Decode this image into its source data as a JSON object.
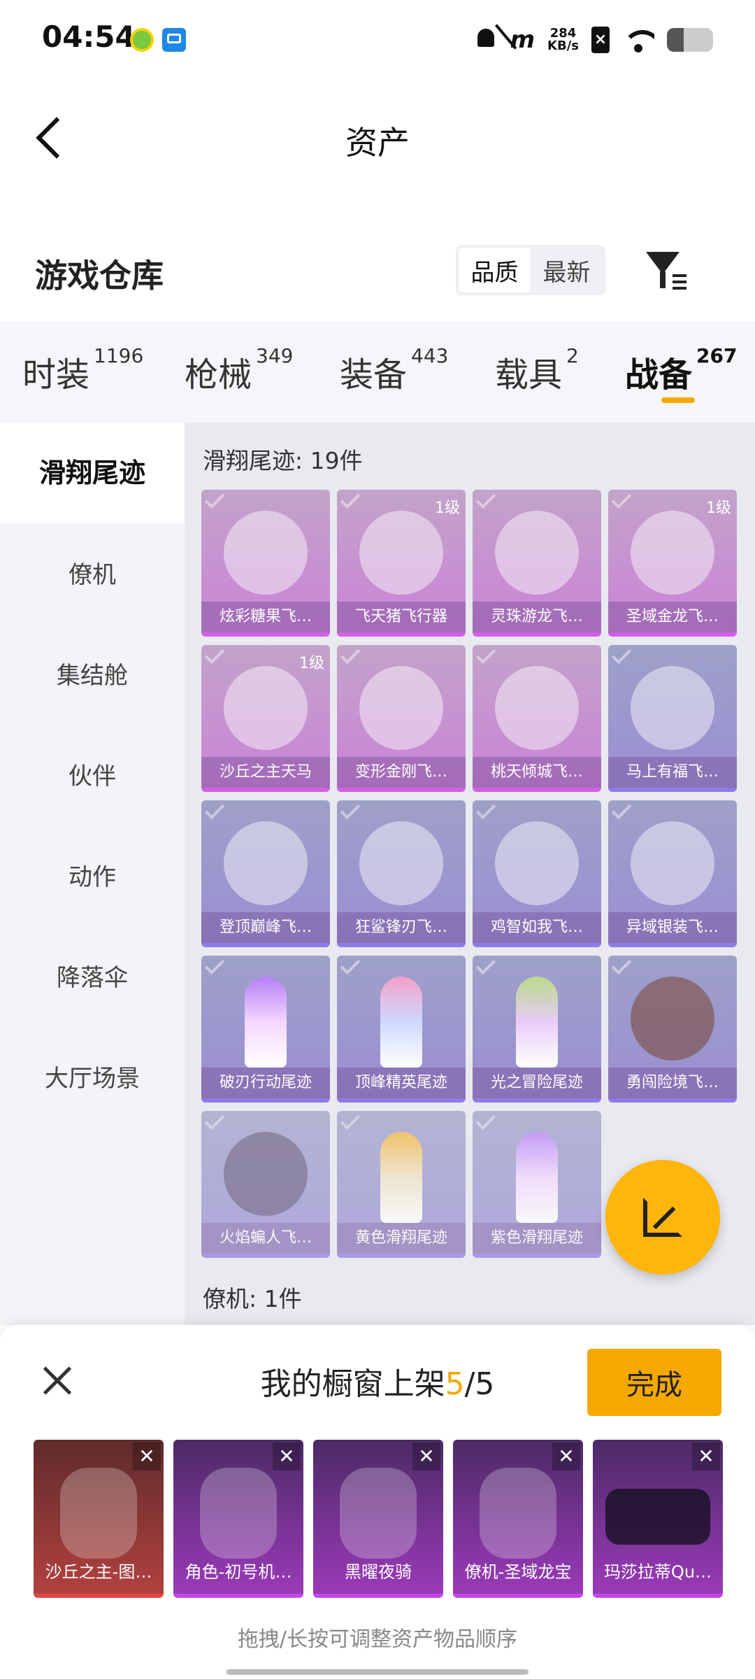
{
  "status": {
    "time": "04:54",
    "speed_top": "284",
    "speed_unit": "KB/s",
    "carrier_mark": "m"
  },
  "header": {
    "title": "资产"
  },
  "warehouse": {
    "title": "游戏仓库",
    "sort_options": [
      "品质",
      "最新"
    ],
    "sort_selected": "品质"
  },
  "tabs": [
    {
      "label": "时装",
      "count": "1196"
    },
    {
      "label": "枪械",
      "count": "349"
    },
    {
      "label": "装备",
      "count": "443"
    },
    {
      "label": "载具",
      "count": "2"
    },
    {
      "label": "战备",
      "count": "267"
    }
  ],
  "sidebar": {
    "items": [
      "滑翔尾迹",
      "僚机",
      "集结舱",
      "伙伴",
      "动作",
      "降落伞",
      "大厅场景"
    ]
  },
  "content": {
    "section1_title": "滑翔尾迹: 19件",
    "section2_title": "僚机: 1件",
    "items": [
      {
        "name": "炫彩糖果飞…",
        "level": "",
        "rarity": "pink"
      },
      {
        "name": "飞天猪飞行器",
        "level": "1级",
        "rarity": "pink"
      },
      {
        "name": "灵珠游龙飞…",
        "level": "",
        "rarity": "pink"
      },
      {
        "name": "圣域金龙飞…",
        "level": "1级",
        "rarity": "pink"
      },
      {
        "name": "沙丘之主天马",
        "level": "1级",
        "rarity": "pink"
      },
      {
        "name": "变形金刚飞…",
        "level": "",
        "rarity": "pink"
      },
      {
        "name": "桃天倾城飞…",
        "level": "",
        "rarity": "pink"
      },
      {
        "name": "马上有福飞…",
        "level": "",
        "rarity": "purple"
      },
      {
        "name": "登顶巅峰飞…",
        "level": "",
        "rarity": "purple"
      },
      {
        "name": "狂鲨锋刃飞…",
        "level": "",
        "rarity": "purple"
      },
      {
        "name": "鸡智如我飞…",
        "level": "",
        "rarity": "purple"
      },
      {
        "name": "异域银装飞…",
        "level": "",
        "rarity": "purple"
      },
      {
        "name": "破刃行动尾迹",
        "level": "",
        "rarity": "purple"
      },
      {
        "name": "顶峰精英尾迹",
        "level": "",
        "rarity": "purple"
      },
      {
        "name": "光之冒险尾迹",
        "level": "",
        "rarity": "purple"
      },
      {
        "name": "勇闯险境飞…",
        "level": "",
        "rarity": "purple"
      },
      {
        "name": "火焰蝙人飞…",
        "level": "",
        "rarity": "purple"
      },
      {
        "name": "黄色滑翔尾迹",
        "level": "",
        "rarity": "purple"
      },
      {
        "name": "紫色滑翔尾迹",
        "level": "",
        "rarity": "purple"
      }
    ]
  },
  "showcase": {
    "title_prefix": "我的橱窗上架",
    "count_current": "5",
    "count_total": "/5",
    "done_label": "完成",
    "close_symbol": "✕",
    "items": [
      {
        "name": "沙丘之主-图…",
        "rarity": "red"
      },
      {
        "name": "角色-初号机…",
        "rarity": "violet"
      },
      {
        "name": "黑曜夜骑",
        "rarity": "violet"
      },
      {
        "name": "僚机-圣域龙宝",
        "rarity": "violet"
      },
      {
        "name": "玛莎拉蒂Qu…",
        "rarity": "violet"
      }
    ],
    "hint": "拖拽/长按可调整资产物品顺序"
  },
  "colors": {
    "accent": "#f5a800",
    "pink_rarity": "#d35fe4",
    "purple_rarity": "#8f7be6",
    "red_rarity": "#e04545"
  }
}
